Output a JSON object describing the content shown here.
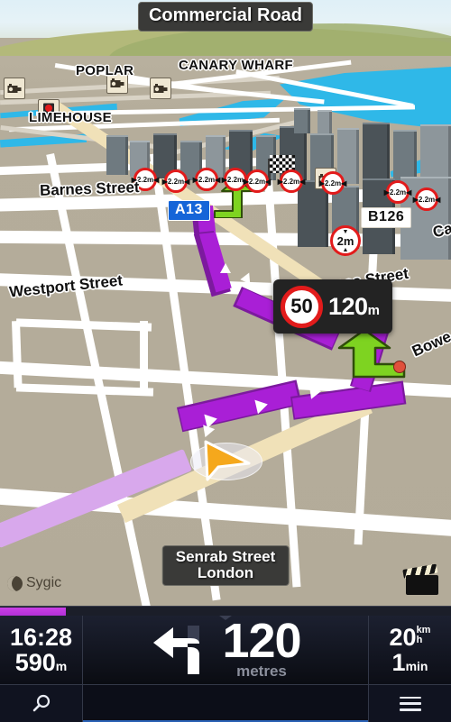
{
  "app": {
    "brand": "Sygic"
  },
  "map": {
    "top_street_label": "Commercial Road",
    "current_street_label_line1": "Senrab Street",
    "current_street_label_line2": "London",
    "districts": [
      {
        "name": "POPLAR"
      },
      {
        "name": "CANARY WHARF"
      },
      {
        "name": "LIMEHOUSE"
      }
    ],
    "street_labels": [
      {
        "name": "Barnes Street"
      },
      {
        "name": "Westport Street"
      },
      {
        "name": "sea Street"
      },
      {
        "name": "Bowe"
      },
      {
        "name": "Ca"
      }
    ],
    "road_shields": [
      {
        "label": "A13",
        "style": "motorway-blue"
      },
      {
        "label": "B126",
        "style": "primary-white"
      }
    ],
    "restriction_signs": [
      {
        "value": "2.2m",
        "type": "width"
      },
      {
        "value": "2.2m",
        "type": "width"
      },
      {
        "value": "2.2m",
        "type": "width"
      },
      {
        "value": "2.2m",
        "type": "width"
      },
      {
        "value": "2.2m",
        "type": "width"
      },
      {
        "value": "2.2m",
        "type": "width"
      },
      {
        "value": "2.2m",
        "type": "width"
      },
      {
        "value": "2.2m",
        "type": "width"
      },
      {
        "value": "2.2m",
        "type": "width"
      },
      {
        "value": "2m",
        "type": "height"
      }
    ],
    "poi_icons": [
      {
        "name": "speed-camera-icon"
      },
      {
        "name": "speed-camera-icon"
      },
      {
        "name": "speed-camera-icon"
      },
      {
        "name": "speed-camera-icon"
      },
      {
        "name": "traffic-light-icon"
      }
    ],
    "destination_marker": "checkered-flag-icon",
    "dashcam_icon": "clapperboard-icon"
  },
  "speed_panel": {
    "speed_limit": "50",
    "distance_value": "120",
    "distance_unit": "m"
  },
  "bottom_bar": {
    "progress_percent": 14.5,
    "eta_time": "16:28",
    "remaining_distance_value": "590",
    "remaining_distance_unit": "m",
    "maneuver_icon": "turn-left-icon",
    "maneuver_distance": "120",
    "maneuver_distance_unit": "metres",
    "speed_value": "20",
    "speed_unit_top": "km",
    "speed_unit_bottom": "h",
    "remaining_time_value": "1",
    "remaining_time_unit": "min",
    "search_icon": "magnifier-icon",
    "menu_icon": "hamburger-menu-icon"
  },
  "colors": {
    "route_purple": "#a91fd6",
    "maneuver_green": "#7ed321",
    "restriction_red": "#e21b1b",
    "shield_blue": "#1565d8",
    "panel_dark": "#232323",
    "bar_dark": "#14161f"
  }
}
